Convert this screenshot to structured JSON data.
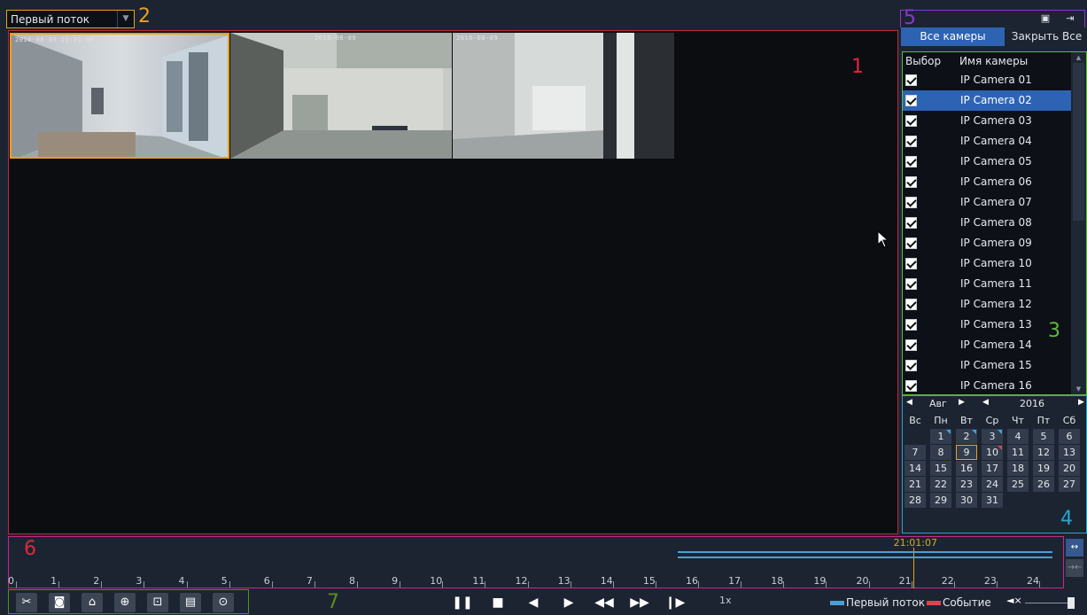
{
  "annotations": {
    "n1": "1",
    "n2": "2",
    "n3": "3",
    "n4": "4",
    "n5": "5",
    "n6": "6",
    "n7": "7"
  },
  "colors": {
    "accent": "#2d63b3",
    "selection_outline": "#e7a21f",
    "timeline_record": "#4a9fd6",
    "timeline_event": "#e0434d"
  },
  "top": {
    "stream_selected": "Первый поток"
  },
  "video": {
    "tiles": [
      {
        "timestamp": "2016-08-09 21:01:08",
        "selected": true
      },
      {
        "timestamp": "2016-08-09",
        "selected": false
      },
      {
        "timestamp": "2016-08-09",
        "selected": false
      }
    ]
  },
  "panel": {
    "tab_all": "Все камеры",
    "tab_close": "Закрыть Все",
    "list_head_select": "Выбор",
    "list_head_name": "Имя камеры",
    "cameras": [
      {
        "name": "IP Camera 01",
        "checked": true,
        "selected": false
      },
      {
        "name": "IP Camera 02",
        "checked": true,
        "selected": true
      },
      {
        "name": "IP Camera 03",
        "checked": true,
        "selected": false
      },
      {
        "name": "IP Camera 04",
        "checked": true,
        "selected": false
      },
      {
        "name": "IP Camera 05",
        "checked": true,
        "selected": false
      },
      {
        "name": "IP Camera 06",
        "checked": true,
        "selected": false
      },
      {
        "name": "IP Camera 07",
        "checked": true,
        "selected": false
      },
      {
        "name": "IP Camera 08",
        "checked": true,
        "selected": false
      },
      {
        "name": "IP Camera 09",
        "checked": true,
        "selected": false
      },
      {
        "name": "IP Camera 10",
        "checked": true,
        "selected": false
      },
      {
        "name": "IP Camera 11",
        "checked": true,
        "selected": false
      },
      {
        "name": "IP Camera 12",
        "checked": true,
        "selected": false
      },
      {
        "name": "IP Camera 13",
        "checked": true,
        "selected": false
      },
      {
        "name": "IP Camera 14",
        "checked": true,
        "selected": false
      },
      {
        "name": "IP Camera 15",
        "checked": true,
        "selected": false
      },
      {
        "name": "IP Camera 16",
        "checked": true,
        "selected": false
      }
    ]
  },
  "calendar": {
    "month": "Авг",
    "year": "2016",
    "weekdays": [
      "Вс",
      "Пн",
      "Вт",
      "Ср",
      "Чт",
      "Пт",
      "Сб"
    ],
    "weeks": [
      [
        "",
        "1",
        "2",
        "3",
        "4",
        "5",
        "6"
      ],
      [
        "7",
        "8",
        "9",
        "10",
        "11",
        "12",
        "13"
      ],
      [
        "14",
        "15",
        "16",
        "17",
        "18",
        "19",
        "20"
      ],
      [
        "21",
        "22",
        "23",
        "24",
        "25",
        "26",
        "27"
      ],
      [
        "28",
        "29",
        "30",
        "31",
        "",
        "",
        ""
      ]
    ],
    "selected_day": "9",
    "days_with_record": [
      "1",
      "2",
      "3"
    ],
    "days_with_event": [
      "10"
    ]
  },
  "timeline": {
    "current_time": "21:01:07",
    "current_hour_value": 21.02,
    "hour_labels": [
      "0",
      "1",
      "2",
      "3",
      "4",
      "5",
      "6",
      "7",
      "8",
      "9",
      "10",
      "11",
      "12",
      "13",
      "14",
      "15",
      "16",
      "17",
      "18",
      "19",
      "20",
      "21",
      "22",
      "23",
      "24"
    ],
    "record_segments_hours": [
      [
        15.5,
        24.0
      ]
    ]
  },
  "toolbar": {
    "tools": [
      {
        "icon": "scissors-icon",
        "glyph": "✂"
      },
      {
        "icon": "camera-snapshot-icon",
        "glyph": "◙"
      },
      {
        "icon": "lock-icon",
        "glyph": "⌂"
      },
      {
        "icon": "add-tag-icon",
        "glyph": "⊕"
      },
      {
        "icon": "tag-list-icon",
        "glyph": "⊡"
      },
      {
        "icon": "save-icon",
        "glyph": "▤"
      },
      {
        "icon": "zoom-icon",
        "glyph": "⊙"
      }
    ],
    "playback": [
      {
        "icon": "pause-icon",
        "glyph": "❚❚"
      },
      {
        "icon": "stop-icon",
        "glyph": "■"
      },
      {
        "icon": "step-back-30s-icon",
        "glyph": "◀"
      },
      {
        "icon": "step-forward-30s-icon",
        "glyph": "▶"
      },
      {
        "icon": "rewind-icon",
        "glyph": "◀◀"
      },
      {
        "icon": "fast-forward-icon",
        "glyph": "▶▶"
      },
      {
        "icon": "frame-step-icon",
        "glyph": "❙▶"
      }
    ],
    "speed": "1x",
    "legend_primary": "Первый поток",
    "legend_event": "Событие",
    "volume_level": 1.0
  }
}
